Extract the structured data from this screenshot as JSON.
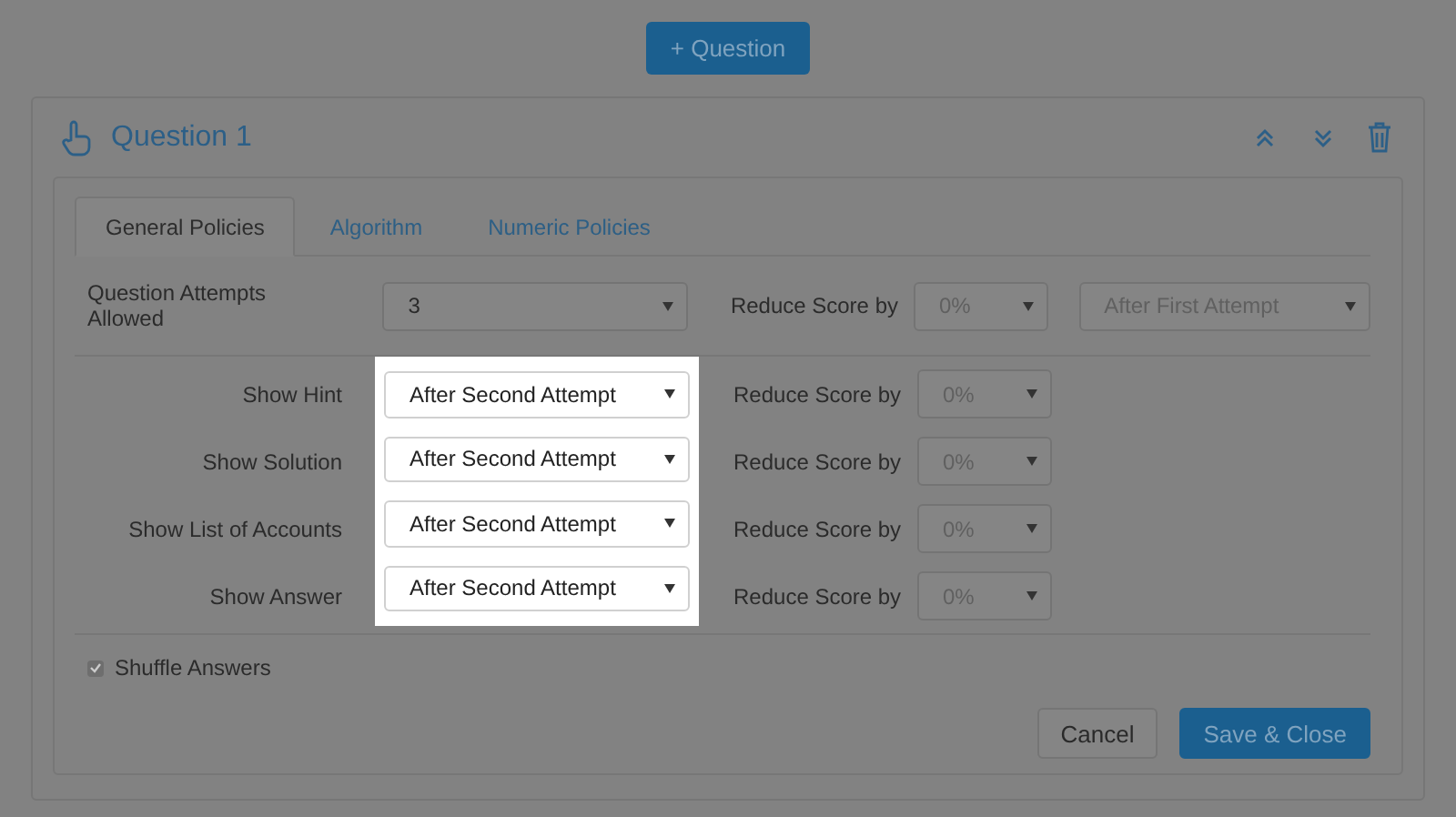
{
  "add_button": "+ Question",
  "question": {
    "title": "Question 1"
  },
  "tabs": [
    {
      "label": "General Policies",
      "selected": true
    },
    {
      "label": "Algorithm",
      "selected": false
    },
    {
      "label": "Numeric Policies",
      "selected": false
    }
  ],
  "attempts_row": {
    "label": "Question Attempts Allowed",
    "value": "3",
    "reduce_label": "Reduce Score by",
    "reduce_value": "0%",
    "reduce_disabled": true,
    "after_value": "After First Attempt",
    "after_disabled": true
  },
  "policy_group": {
    "spotlight": true,
    "rows": [
      {
        "label": "Show Hint",
        "value": "After Second Attempt",
        "reduce_label": "Reduce Score by",
        "reduce_value": "0%",
        "reduce_disabled": true
      },
      {
        "label": "Show Solution",
        "value": "After Second Attempt",
        "reduce_label": "Reduce Score by",
        "reduce_value": "0%",
        "reduce_disabled": true
      },
      {
        "label": "Show List of Accounts",
        "value": "After Second Attempt",
        "reduce_label": "Reduce Score by",
        "reduce_value": "0%",
        "reduce_disabled": true
      },
      {
        "label": "Show Answer",
        "value": "After Second Attempt",
        "reduce_label": "Reduce Score by",
        "reduce_value": "0%",
        "reduce_disabled": true
      }
    ]
  },
  "shuffle": {
    "label": "Shuffle Answers",
    "checked": true
  },
  "buttons": [
    {
      "label": "Cancel",
      "kind": "secondary"
    },
    {
      "label": "Save & Close",
      "kind": "primary"
    }
  ]
}
